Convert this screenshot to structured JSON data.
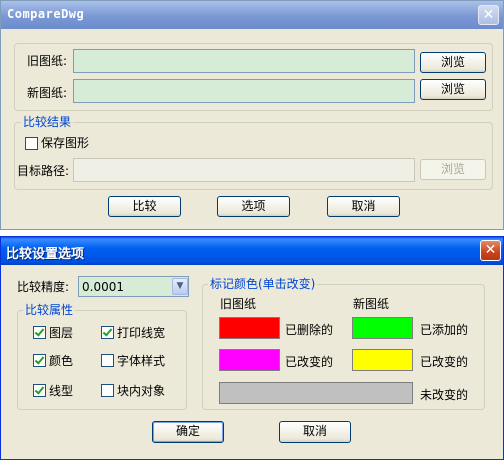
{
  "compare_window": {
    "title": "CompareDwg",
    "close_icon": "close-icon",
    "old_drawing_label": "旧图纸:",
    "new_drawing_label": "新图纸:",
    "old_drawing_value": "",
    "new_drawing_value": "",
    "browse_label": "浏览",
    "result_group_label": "比较结果",
    "save_graphics_label": "保存图形",
    "save_graphics_checked": false,
    "target_path_label": "目标路径:",
    "target_path_value": "",
    "compare_button": "比较",
    "options_button": "选项",
    "cancel_button": "取消"
  },
  "options_dialog": {
    "title": "比较设置选项",
    "close_icon": "close-icon",
    "precision_label": "比较精度:",
    "precision_value": "0.0001",
    "attributes_group_label": "比较属性",
    "attributes": [
      {
        "label": "图层",
        "checked": true
      },
      {
        "label": "颜色",
        "checked": true
      },
      {
        "label": "线型",
        "checked": true
      },
      {
        "label": "打印线宽",
        "checked": true
      },
      {
        "label": "字体样式",
        "checked": false
      },
      {
        "label": "块内对象",
        "checked": false
      }
    ],
    "marker_colors_group_label": "标记颜色(单击改变)",
    "old_drawing_header": "旧图纸",
    "new_drawing_header": "新图纸",
    "deleted_label": "已删除的",
    "added_label": "已添加的",
    "changed_old_label": "已改变的",
    "changed_new_label": "已改变的",
    "unchanged_label": "未改变的",
    "colors": {
      "deleted": "#ff0000",
      "added": "#00ff00",
      "changed_old": "#ff00ff",
      "changed_new": "#ffff00",
      "unchanged": "#c0c0c0"
    },
    "ok_button": "确定",
    "cancel_button": "取消"
  }
}
